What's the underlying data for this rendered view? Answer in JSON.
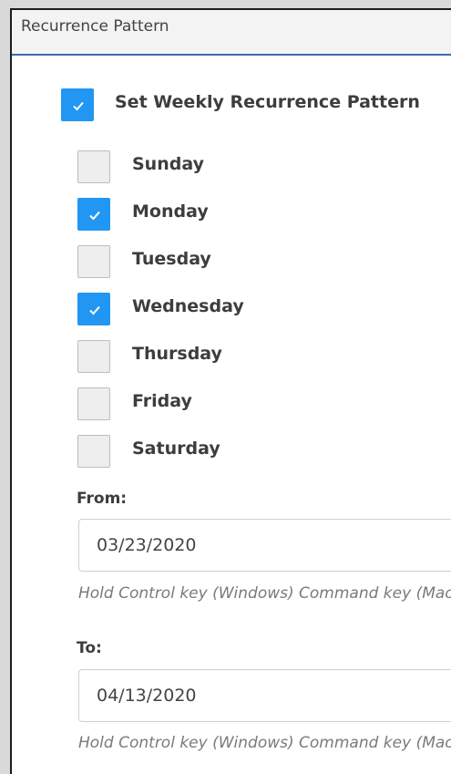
{
  "header": {
    "title": "Recurrence Pattern"
  },
  "weekly": {
    "label": "Set Weekly Recurrence Pattern",
    "checked": true
  },
  "days": [
    {
      "label": "Sunday",
      "checked": false
    },
    {
      "label": "Monday",
      "checked": true
    },
    {
      "label": "Tuesday",
      "checked": false
    },
    {
      "label": "Wednesday",
      "checked": true
    },
    {
      "label": "Thursday",
      "checked": false
    },
    {
      "label": "Friday",
      "checked": false
    },
    {
      "label": "Saturday",
      "checked": false
    }
  ],
  "from": {
    "label": "From:",
    "value": "03/23/2020",
    "hint": "Hold Control key (Windows) Command key (Mac) to select multiple"
  },
  "to": {
    "label": "To:",
    "value": "04/13/2020",
    "hint": "Hold Control key (Windows) Command key (Mac) to select multiple"
  },
  "colors": {
    "accent": "#2196f3",
    "header_border": "#3a6fa8"
  },
  "icons": {
    "check": "checkmark-icon"
  }
}
